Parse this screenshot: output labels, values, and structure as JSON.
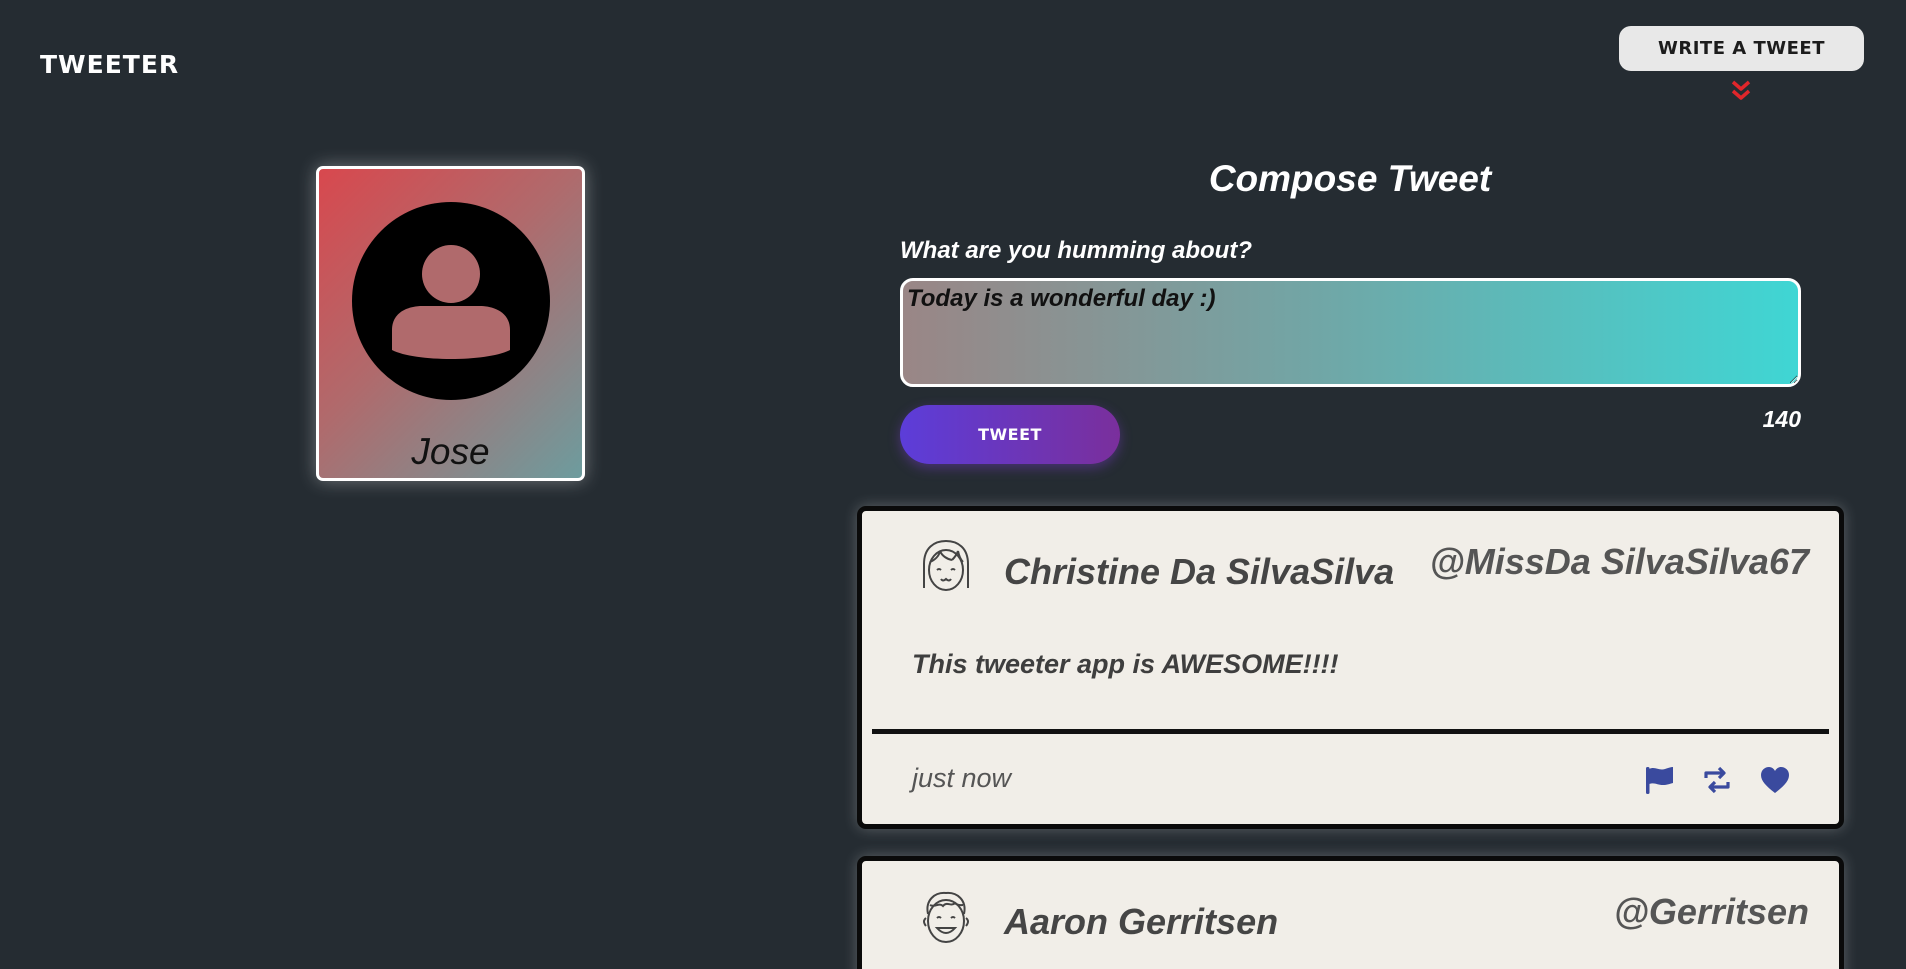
{
  "header": {
    "brand": "TWEETER",
    "write_button": "WRITE A TWEET"
  },
  "colors": {
    "background": "#252c32",
    "chevron": "#e0262b",
    "action_icons": "#3a4a9e"
  },
  "profile": {
    "name": "Jose"
  },
  "compose": {
    "title": "Compose Tweet",
    "prompt": "What are you humming about?",
    "input_value": "Today is a wonderful day :)",
    "submit_label": "TWEET",
    "char_count": "140"
  },
  "tweets": [
    {
      "name": "Christine Da SilvaSilva",
      "handle": "@MissDa SilvaSilva67",
      "text": "This tweeter app is AWESOME!!!!",
      "time": "just now",
      "avatar": "girl-face-icon"
    },
    {
      "name": "Aaron Gerritsen",
      "handle": "@Gerritsen",
      "avatar": "boy-face-icon"
    }
  ],
  "icons": {
    "flag": "flag-icon",
    "retweet": "retweet-icon",
    "like": "heart-icon",
    "chevron": "chevron-double-down-icon",
    "profile_avatar": "user-avatar-icon"
  }
}
